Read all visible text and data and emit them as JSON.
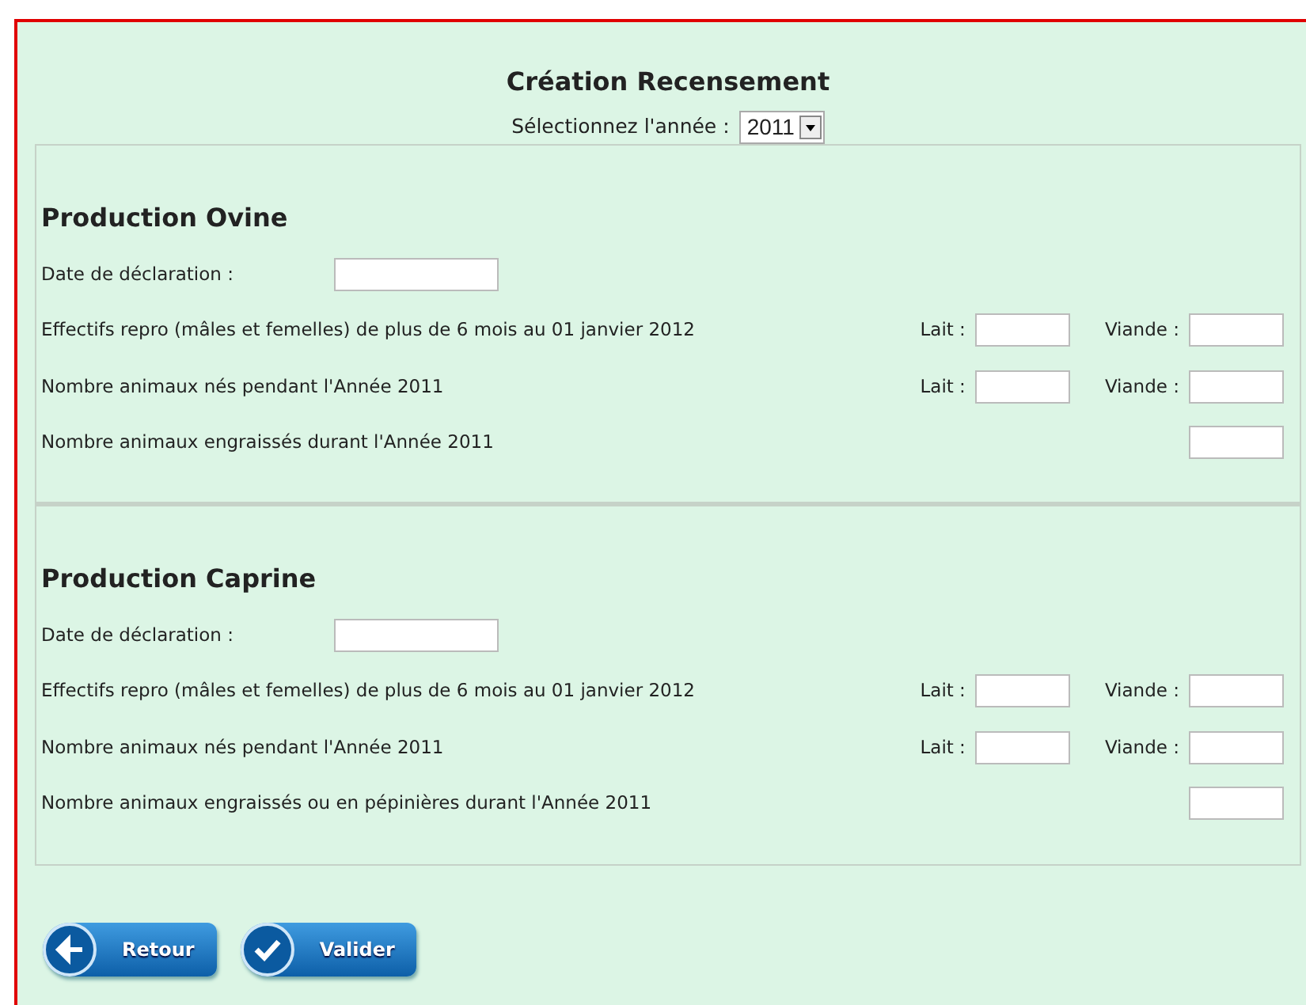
{
  "title": "Création Recensement",
  "year_select": {
    "label": "Sélectionnez l'année  :",
    "value": "2011"
  },
  "sections": [
    {
      "heading": "Production Ovine",
      "rows": [
        {
          "kind": "date",
          "label": "Date de déclaration :"
        },
        {
          "kind": "pair",
          "label": "Effectifs repro (mâles et femelles) de plus de 6 mois au 01 janvier 2012",
          "first": "Lait :",
          "second": "Viande :"
        },
        {
          "kind": "pair",
          "label": "Nombre animaux nés pendant l'Année 2011",
          "first": "Lait :",
          "second": "Viande :"
        },
        {
          "kind": "single",
          "label": "Nombre animaux engraissés durant l'Année 2011"
        }
      ]
    },
    {
      "heading": "Production Caprine",
      "rows": [
        {
          "kind": "date",
          "label": "Date de déclaration :"
        },
        {
          "kind": "pair",
          "label": "Effectifs repro (mâles et femelles) de plus de 6 mois au 01 janvier 2012",
          "first": "Lait :",
          "second": "Viande :"
        },
        {
          "kind": "pair",
          "label": "Nombre animaux nés pendant l'Année 2011",
          "first": "Lait :",
          "second": "Viande :"
        },
        {
          "kind": "single",
          "label": "Nombre animaux engraissés ou en pépinières durant l'Année 2011"
        }
      ]
    }
  ],
  "buttons": [
    {
      "kind": "back",
      "label": "Retour"
    },
    {
      "kind": "check",
      "label": "Valider"
    }
  ]
}
